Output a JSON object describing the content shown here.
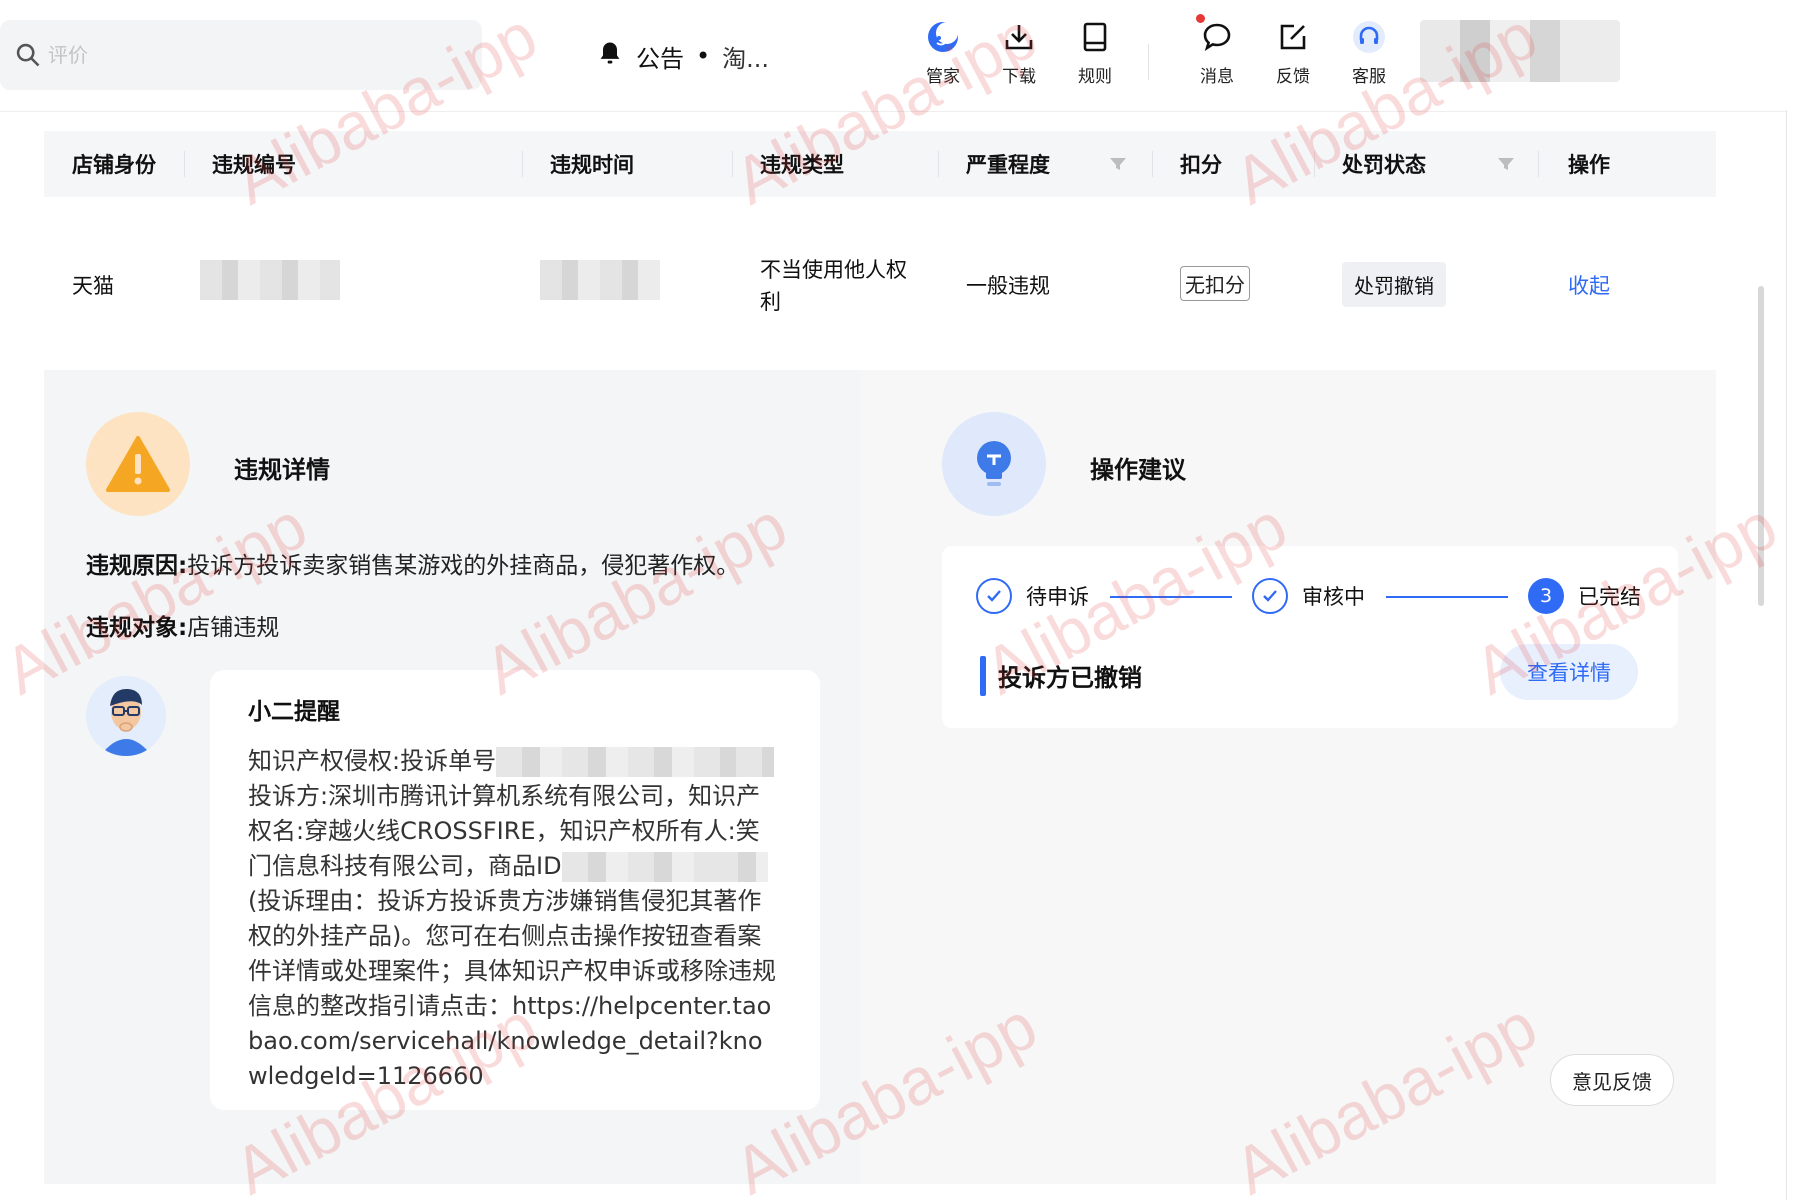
{
  "search": {
    "placeholder": "评价"
  },
  "notice": {
    "label": "公告",
    "separator": "•",
    "text": "淘..."
  },
  "toolbar": {
    "items": [
      {
        "label": "管家",
        "icon": "moon-icon"
      },
      {
        "label": "下载",
        "icon": "download-icon"
      },
      {
        "label": "规则",
        "icon": "book-icon"
      },
      {
        "label": "消息",
        "icon": "chat-bubble-icon"
      },
      {
        "label": "反馈",
        "icon": "edit-icon"
      },
      {
        "label": "客服",
        "icon": "headset-icon"
      }
    ]
  },
  "table": {
    "headers": [
      "店铺身份",
      "违规编号",
      "违规时间",
      "违规类型",
      "严重程度",
      "扣分",
      "处罚状态",
      "操作"
    ],
    "row": {
      "shop_identity": "天猫",
      "violation_type_line1": "不当使用他人权",
      "violation_type_line2": "利",
      "severity": "一般违规",
      "deduction": "无扣分",
      "penalty_status": "处罚撤销",
      "action": "收起"
    }
  },
  "violation_detail": {
    "title": "违规详情",
    "reason_label": "违规原因:",
    "reason_value": "投诉方投诉卖家销售某游戏的外挂商品，侵犯著作权。",
    "target_label": "违规对象:",
    "target_value": "店铺违规",
    "reminder_title": "小二提醒",
    "reminder_part1": "知识产权侵权:投诉单号",
    "reminder_part2": "投诉方:深圳市腾讯计算机系统有限公司，知识产权名:穿越火线CROSSFIRE，知识产权所有人:笑门信息科技有限公司，商品ID",
    "reminder_part3": "(投诉理由：投诉方投诉贵方涉嫌销售侵犯其著作权的外挂产品)。您可在右侧点击操作按钮查看案件详情或处理案件；具体知识产权申诉或移除违规信息的整改指引请点击：https://helpcenter.taobao.com/servicehall/knowledge_detail?knowledgeId=1126660"
  },
  "suggestion": {
    "title": "操作建议",
    "steps": [
      {
        "label": "待申诉",
        "state": "done"
      },
      {
        "label": "审核中",
        "state": "done"
      },
      {
        "label": "已完结",
        "state": "current",
        "number": "3"
      }
    ],
    "status_text": "投诉方已撤销",
    "detail_button": "查看详情"
  },
  "feedback_button": "意见反馈",
  "watermark": "Alibaba-ipp",
  "colors": {
    "accent": "#2f6bf5",
    "warning": "#f5a623",
    "warning_bg": "#fde3c2",
    "watermark": "#e53935"
  }
}
